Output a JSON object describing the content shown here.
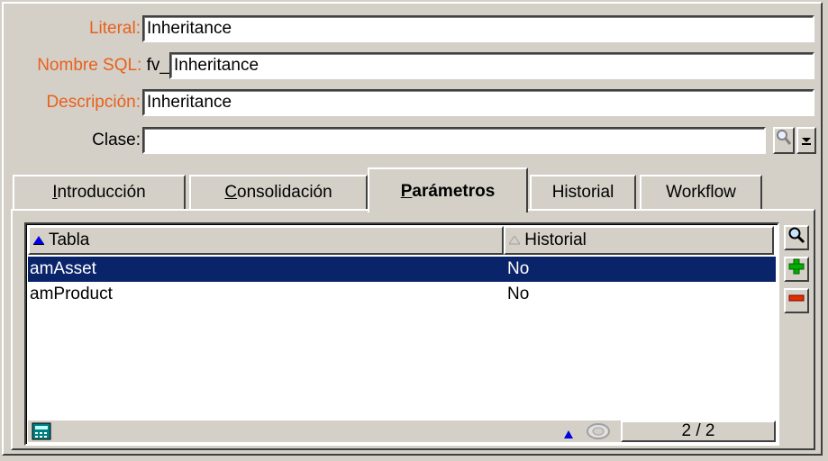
{
  "form": {
    "literal_label": "Literal:",
    "literal_value": "Inheritance",
    "sql_label": "Nombre SQL:",
    "sql_prefix": "fv_",
    "sql_value": "Inheritance",
    "desc_label": "Descripción:",
    "desc_value": "Inheritance",
    "class_label": "Clase:",
    "class_value": ""
  },
  "tabs": {
    "intro_first": "I",
    "intro_rest": "ntroducción",
    "consol_first": "C",
    "consol_rest": "onsolidación",
    "param_first": "P",
    "param_rest": "arámetros",
    "historial": "Historial",
    "workflow": "Workflow"
  },
  "grid": {
    "col_tabla": "Tabla",
    "col_historial": "Historial",
    "rows": [
      {
        "tabla": "amAsset",
        "historial": "No"
      },
      {
        "tabla": "amProduct",
        "historial": "No"
      }
    ],
    "counter": "2 / 2"
  },
  "colors": {
    "required_label": "#e8601c",
    "selection": "#0a246a",
    "face": "#d4d0c8"
  },
  "icons": {
    "class_zoom": "magnifier-icon",
    "class_dropdown": "dropdown-arrow-icon",
    "side_zoom": "magnifier-icon",
    "side_add": "plus-icon",
    "side_remove": "minus-icon",
    "status_left": "calculator-icon",
    "status_sort": "sort-up-icon",
    "status_refresh": "refresh-icon"
  }
}
